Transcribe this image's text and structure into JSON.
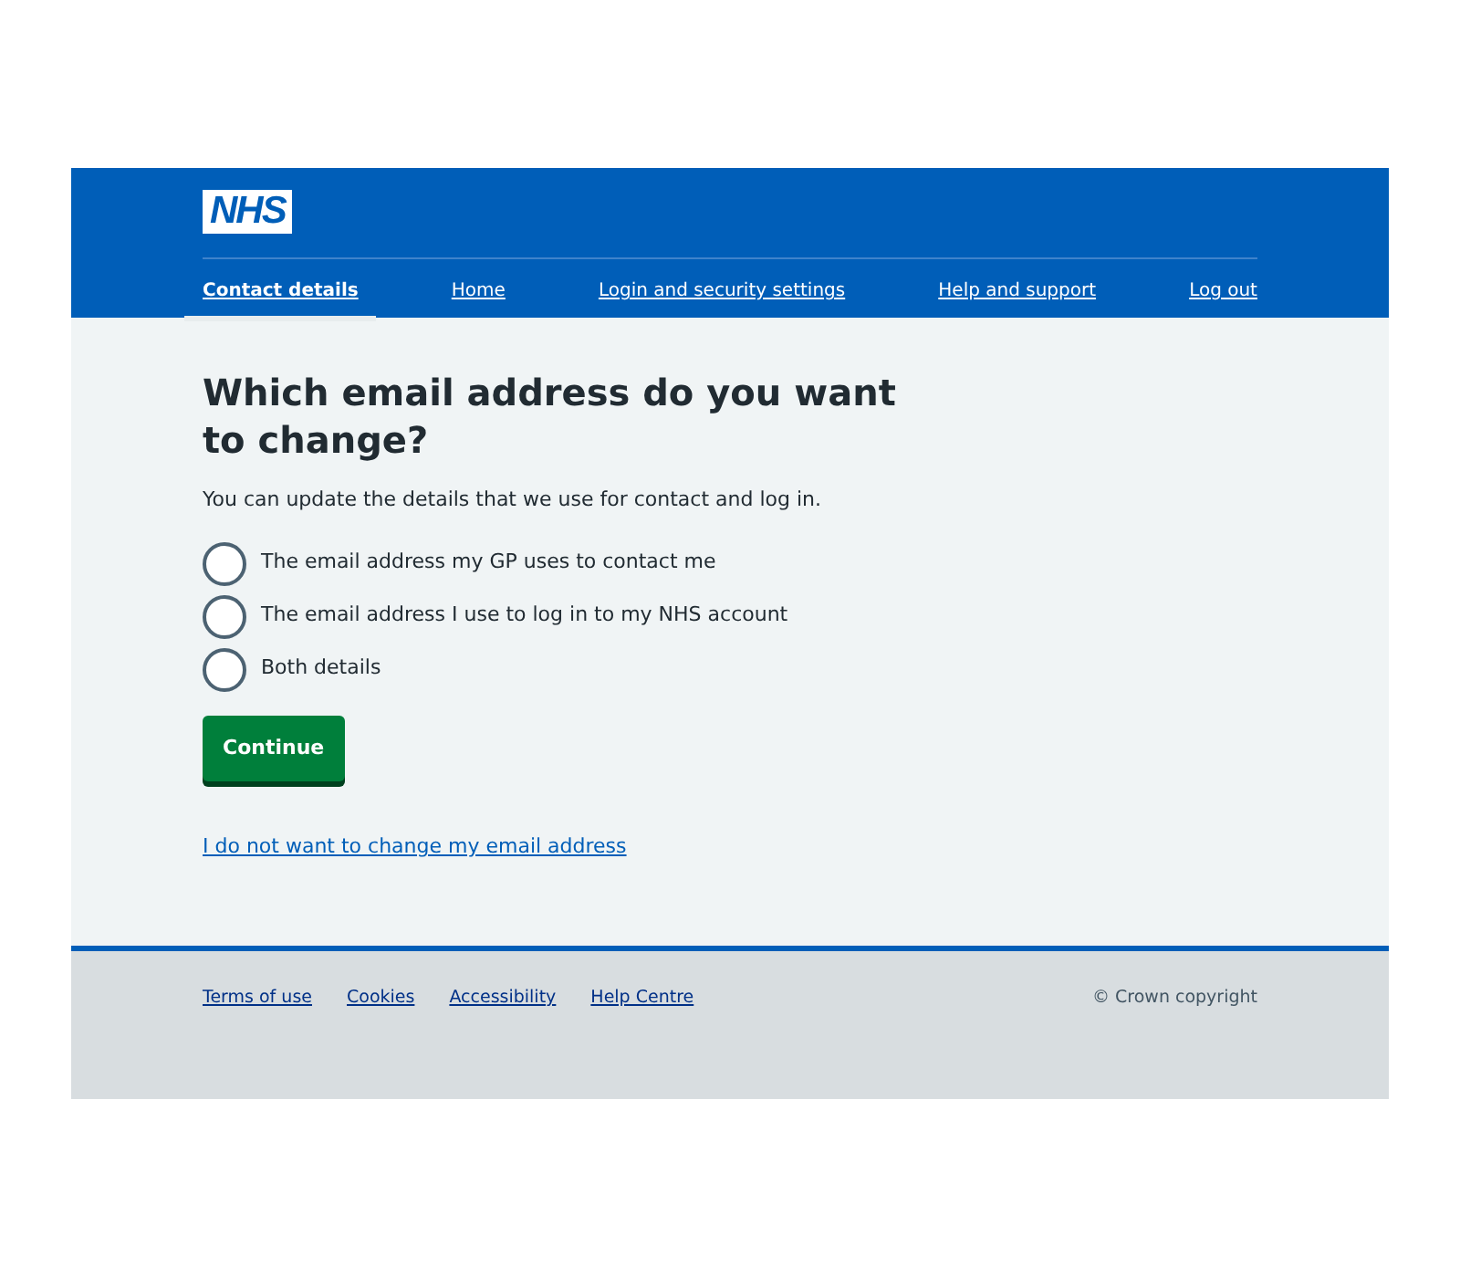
{
  "header": {
    "logo": "NHS",
    "nav": [
      {
        "label": "Contact details",
        "selected": true
      },
      {
        "label": "Home",
        "selected": false
      },
      {
        "label": "Login and security settings",
        "selected": false
      },
      {
        "label": "Help and support",
        "selected": false
      },
      {
        "label": "Log out",
        "selected": false
      }
    ]
  },
  "main": {
    "title": "Which email address do you want to change?",
    "hint": "You can update the details that we use for contact and log in.",
    "options": [
      {
        "label": "The email address my GP uses to contact me",
        "selected": false
      },
      {
        "label": "The email address I use to log in to my NHS account",
        "selected": false
      },
      {
        "label": "Both details",
        "selected": false
      }
    ],
    "button": "Continue",
    "link": "I do not want to change my email address"
  },
  "footer": {
    "links": [
      "Terms of use",
      "Cookies",
      "Accessibility",
      "Help Centre"
    ],
    "copyright": "© Crown copyright"
  }
}
